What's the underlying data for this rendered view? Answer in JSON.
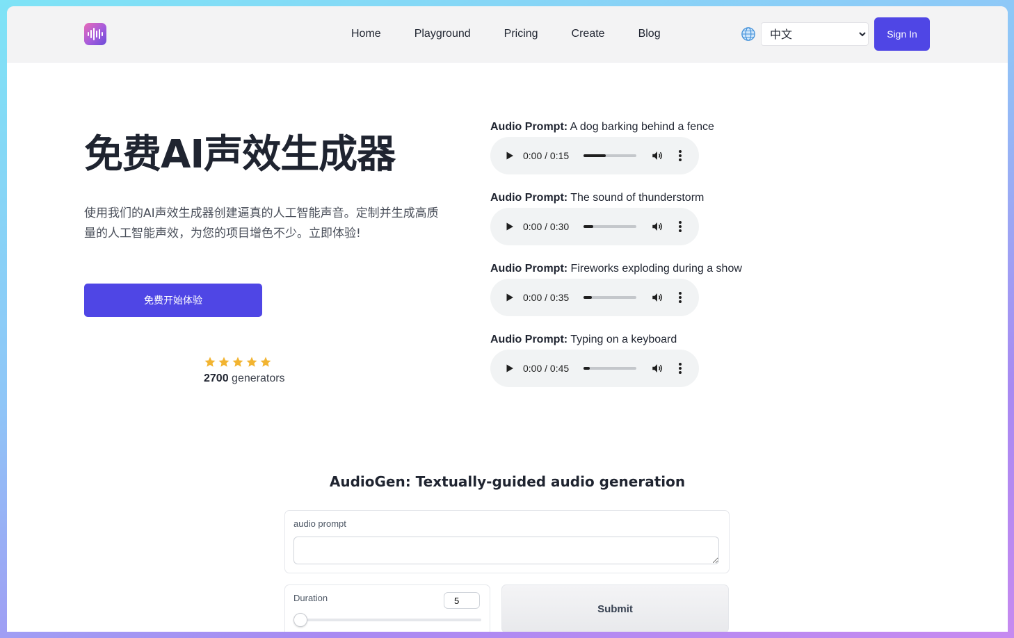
{
  "nav": {
    "links": [
      "Home",
      "Playground",
      "Pricing",
      "Create",
      "Blog"
    ],
    "language_selected": "中文",
    "sign_in": "Sign In",
    "logo_icon": "soundwave-icon",
    "brand_color": "#4f46e5"
  },
  "hero": {
    "title": "免费AI声效生成器",
    "description": "使用我们的AI声效生成器创建逼真的人工智能声音。定制并生成高质量的人工智能声效，为您的项目增色不少。立即体验!",
    "cta": "免费开始体验",
    "rating_stars": 5,
    "generators_count": "2700",
    "generators_label": "generators"
  },
  "audio": {
    "prompt_label": "Audio Prompt:",
    "items": [
      {
        "prompt": "A dog barking behind a fence",
        "current": "0:00",
        "duration": "0:15",
        "progress": 0.42
      },
      {
        "prompt": "The sound of thunderstorm",
        "current": "0:00",
        "duration": "0:30",
        "progress": 0.18
      },
      {
        "prompt": "Fireworks exploding during a show",
        "current": "0:00",
        "duration": "0:35",
        "progress": 0.16
      },
      {
        "prompt": "Typing on a keyboard",
        "current": "0:00",
        "duration": "0:45",
        "progress": 0.12
      }
    ]
  },
  "audiogen": {
    "title": "AudioGen: Textually-guided audio generation",
    "prompt_label": "audio prompt",
    "prompt_value": "",
    "duration_label": "Duration",
    "duration_value": "5",
    "submit": "Submit"
  }
}
